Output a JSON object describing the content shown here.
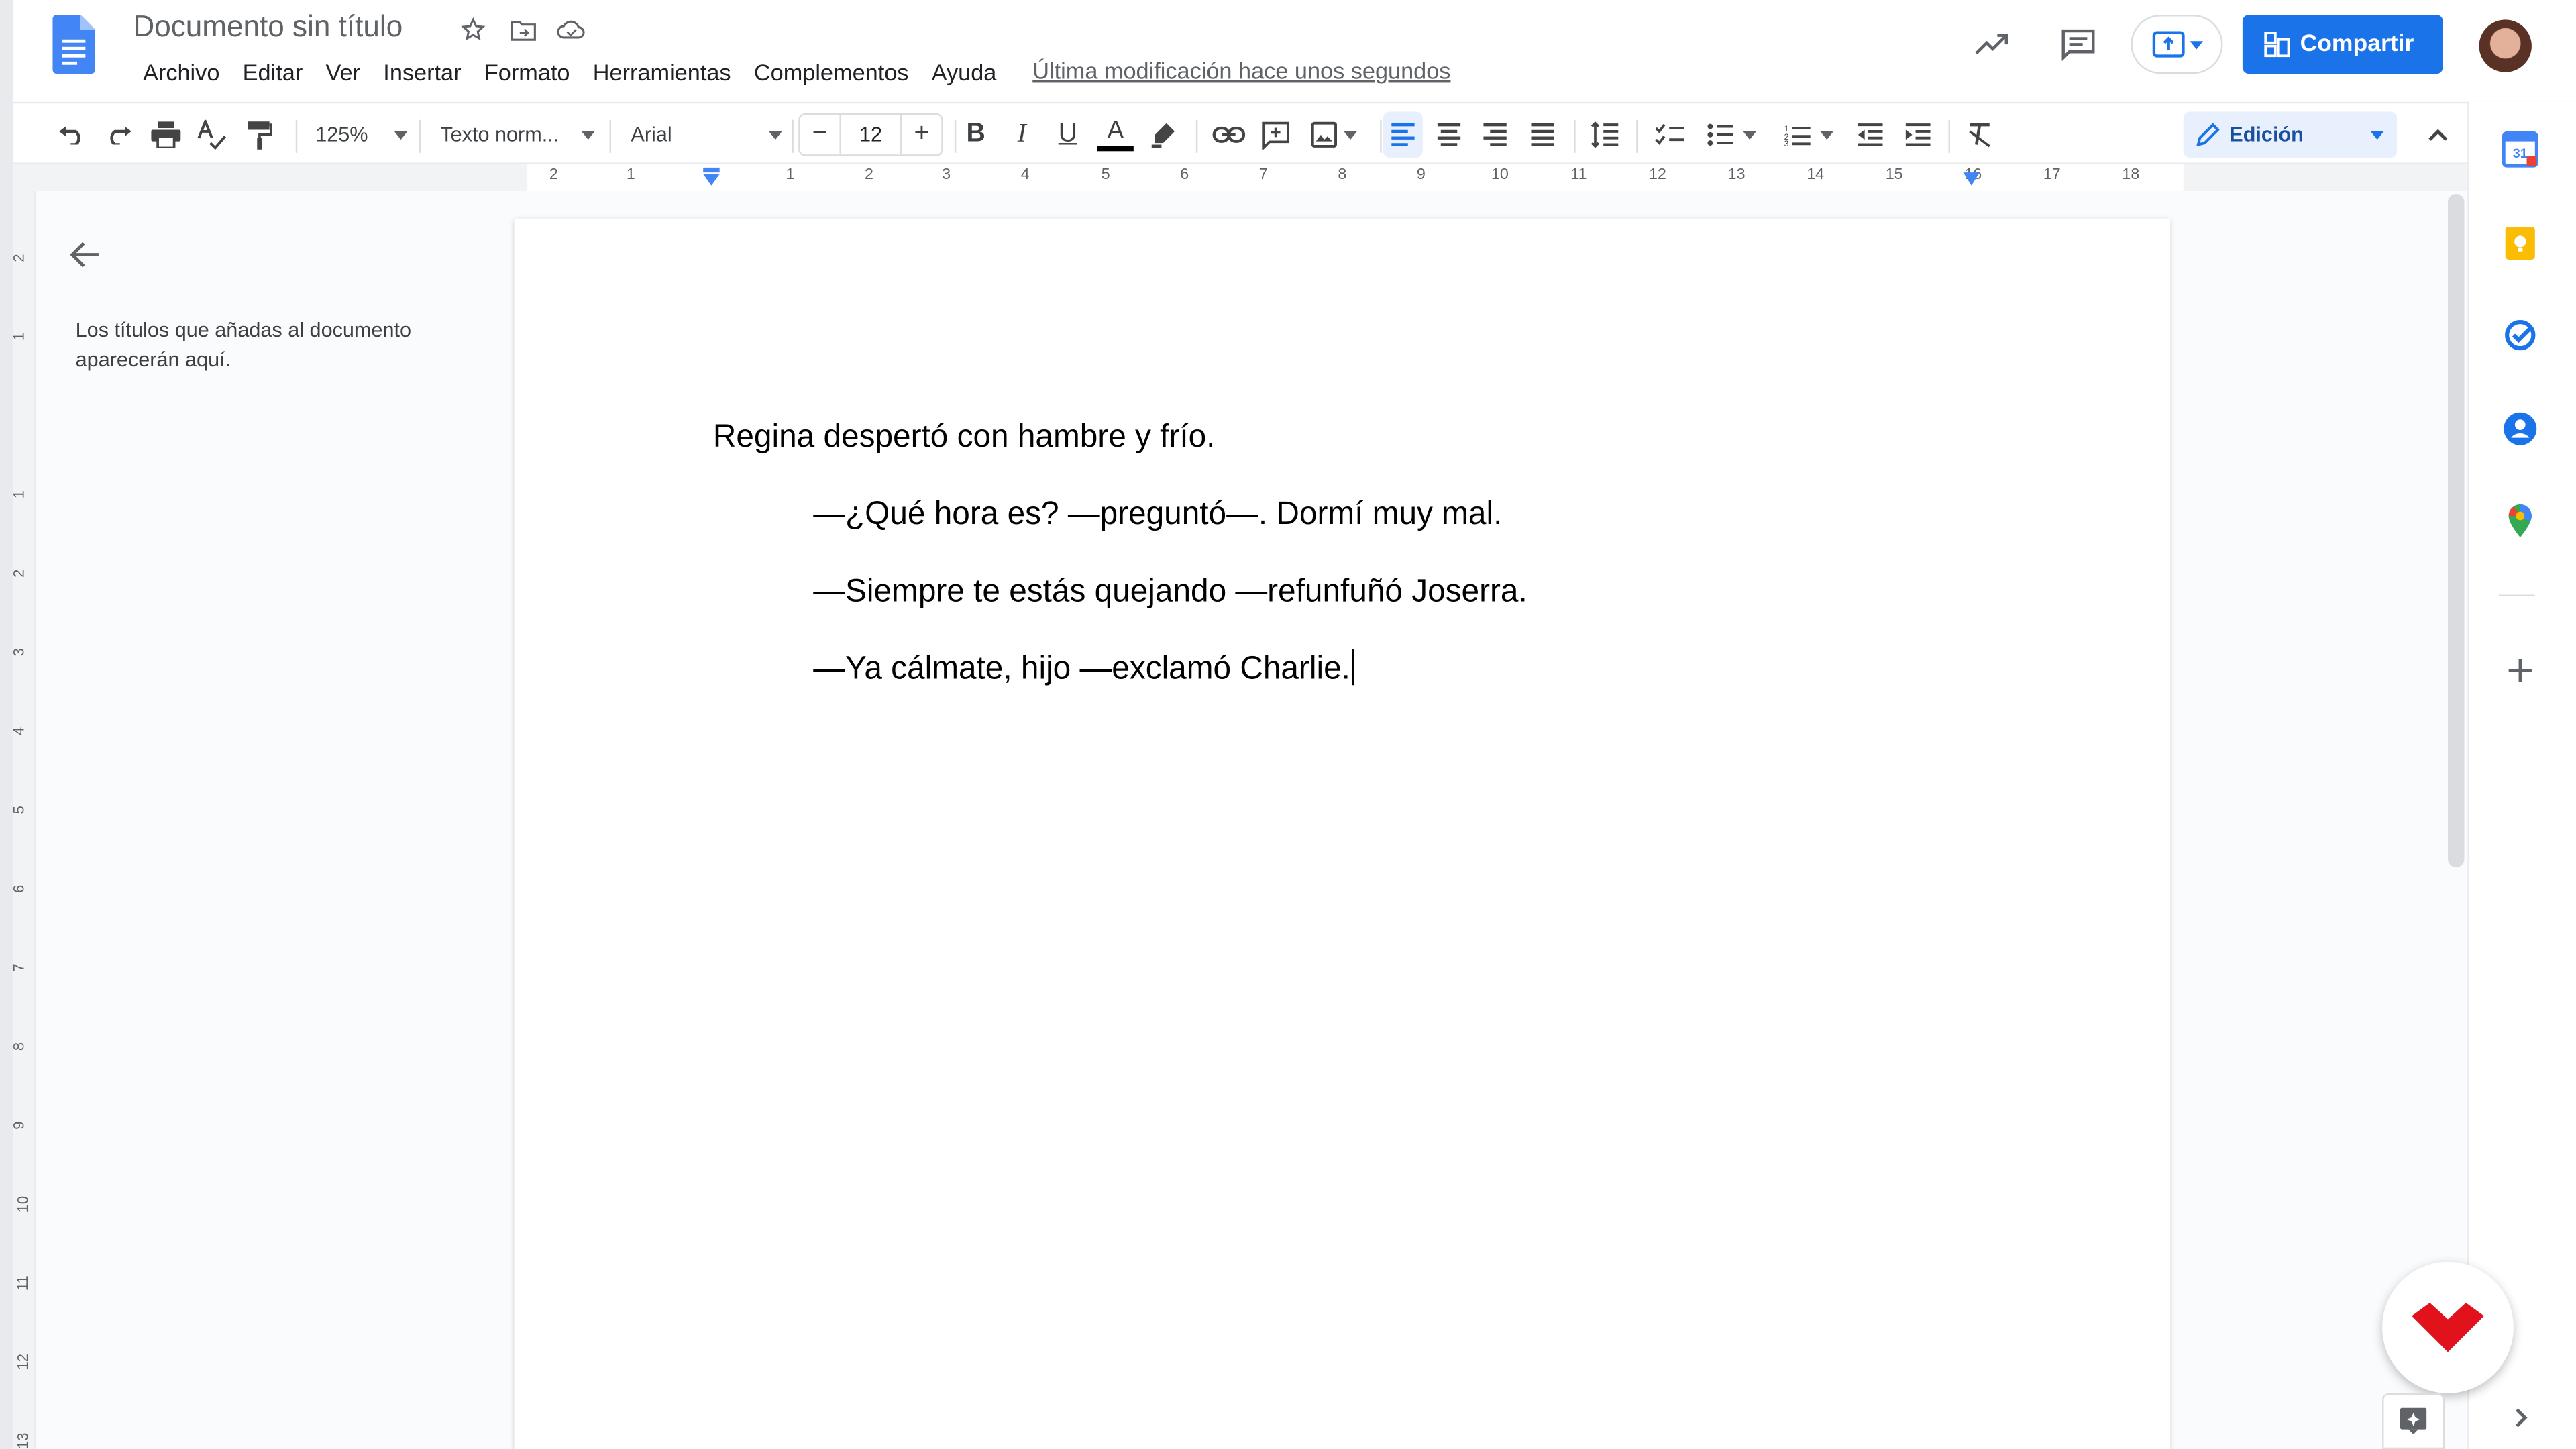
{
  "header": {
    "doc_title": "Documento sin título",
    "menus": [
      "Archivo",
      "Editar",
      "Ver",
      "Insertar",
      "Formato",
      "Herramientas",
      "Complementos",
      "Ayuda"
    ],
    "last_modified": "Última modificación hace unos segundos",
    "share_label": "Compartir"
  },
  "toolbar": {
    "zoom": "125%",
    "style": "Texto norm...",
    "font": "Arial",
    "font_size": "12",
    "minus": "−",
    "plus": "+",
    "mode": "Edición"
  },
  "ruler": {
    "h_labels": [
      "2",
      "1",
      "1",
      "2",
      "3",
      "4",
      "5",
      "6",
      "7",
      "8",
      "9",
      "10",
      "11",
      "12",
      "13",
      "14",
      "15",
      "16",
      "17",
      "18"
    ],
    "v_labels": [
      "2",
      "1",
      "1",
      "2",
      "3",
      "4",
      "5",
      "6",
      "7",
      "8",
      "9",
      "10",
      "11",
      "12",
      "13"
    ]
  },
  "outline": {
    "empty_text": "Los títulos que añadas al documento aparecerán aquí."
  },
  "document": {
    "paragraphs": [
      "Regina despertó con hambre y frío.",
      "—¿Qué hora es? —preguntó—. Dormí muy mal.",
      "—Siempre te estás quejando —refunfuñó Joserra.",
      "—Ya cálmate, hijo —exclamó Charlie."
    ]
  },
  "colors": {
    "accent": "#1a73e8",
    "brand_badge": "#e1121b"
  },
  "icons": [
    "docs-logo-icon",
    "star-icon",
    "move-folder-icon",
    "cloud-status-icon",
    "activity-trend-icon",
    "comments-icon",
    "present-icon",
    "share-lock-icon",
    "calendar-icon",
    "keep-icon",
    "tasks-icon",
    "contacts-icon",
    "maps-icon",
    "add-icon",
    "explore-icon"
  ]
}
